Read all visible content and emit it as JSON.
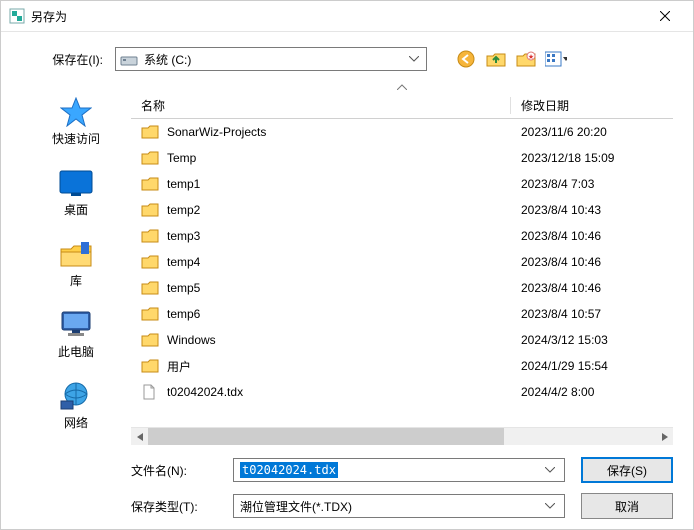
{
  "window": {
    "title": "另存为"
  },
  "top": {
    "save_in_label": "保存在(I):",
    "drive_label": "系统 (C:)"
  },
  "places": {
    "quick_access": "快速访问",
    "desktop": "桌面",
    "libraries": "库",
    "this_pc": "此电脑",
    "network": "网络"
  },
  "columns": {
    "name": "名称",
    "date": "修改日期"
  },
  "rows": [
    {
      "name": "SonarWiz-Projects",
      "date": "2023/11/6 20:20",
      "type": "folder"
    },
    {
      "name": "Temp",
      "date": "2023/12/18 15:09",
      "type": "folder"
    },
    {
      "name": "temp1",
      "date": "2023/8/4 7:03",
      "type": "folder"
    },
    {
      "name": "temp2",
      "date": "2023/8/4 10:43",
      "type": "folder"
    },
    {
      "name": "temp3",
      "date": "2023/8/4 10:46",
      "type": "folder"
    },
    {
      "name": "temp4",
      "date": "2023/8/4 10:46",
      "type": "folder"
    },
    {
      "name": "temp5",
      "date": "2023/8/4 10:46",
      "type": "folder"
    },
    {
      "name": "temp6",
      "date": "2023/8/4 10:57",
      "type": "folder"
    },
    {
      "name": "Windows",
      "date": "2024/3/12 15:03",
      "type": "folder"
    },
    {
      "name": "用户",
      "date": "2024/1/29 15:54",
      "type": "folder"
    },
    {
      "name": "t02042024.tdx",
      "date": "2024/4/2 8:00",
      "type": "file"
    }
  ],
  "form": {
    "filename_label": "文件名(N):",
    "filename_value": "t02042024.tdx",
    "filetype_label": "保存类型(T):",
    "filetype_value": "潮位管理文件(*.TDX)",
    "save_button": "保存(S)",
    "cancel_button": "取消"
  }
}
